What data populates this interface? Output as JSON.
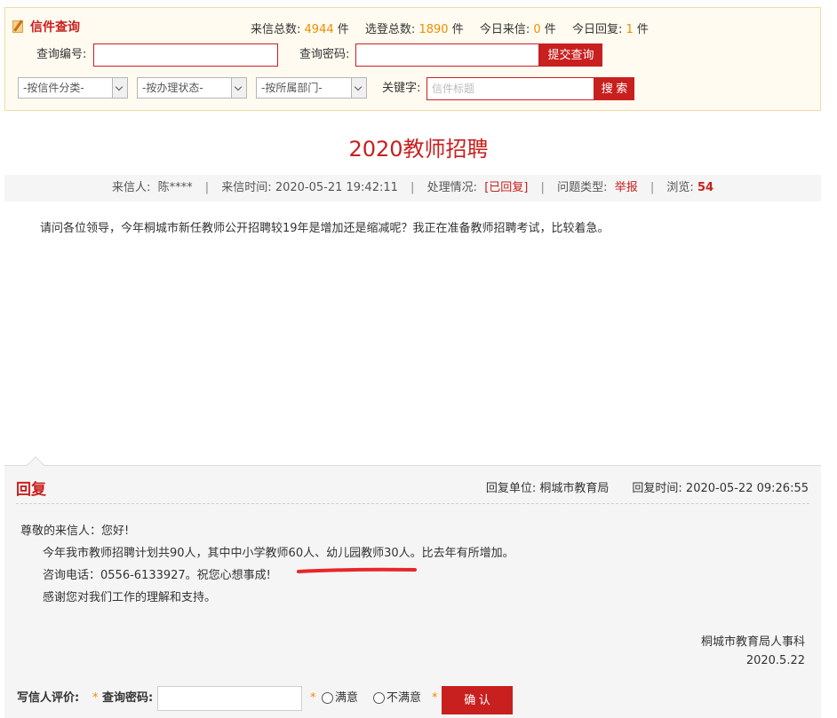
{
  "query": {
    "title": "信件查询",
    "stats": {
      "total_label": "来信总数:",
      "total_value": "4944",
      "selected_label": "选登总数:",
      "selected_value": "1890",
      "today_in_label": "今日来信:",
      "today_in_value": "0",
      "today_reply_label": "今日回复:",
      "today_reply_value": "1",
      "unit": "件"
    },
    "number_label": "查询编号:",
    "number_value": "",
    "password_label": "查询密码:",
    "password_value": "",
    "submit_label": "提交查询",
    "category_select": "-按信件分类-",
    "status_select": "-按办理状态-",
    "department_select": "-按所属部门-",
    "keyword_label": "关键字:",
    "keyword_placeholder": "信件标题",
    "search_label": "搜 索"
  },
  "letter": {
    "title": "2020教师招聘",
    "sender_label": "来信人:",
    "sender": "陈****",
    "time_label": "来信时间:",
    "time": "2020-05-21 19:42:11",
    "status_label": "处理情况:",
    "status": "[已回复]",
    "type_label": "问题类型:",
    "type": "举报",
    "views_label": "浏览:",
    "views": "54",
    "separator": "|",
    "body": "请问各位领导，今年桐城市新任教师公开招聘较19年是增加还是缩减呢？我正在准备教师招聘考试，比较着急。"
  },
  "reply": {
    "heading": "回复",
    "unit_label": "回复单位:",
    "unit": "桐城市教育局",
    "time_label": "回复时间:",
    "time": "2020-05-22 09:26:55",
    "greeting": "尊敬的来信人：您好!",
    "line1": "今年我市教师招聘计划共90人，其中中小学教师60人、幼儿园教师30人。比去年有所增加。",
    "line2": "咨询电话：0556-6133927。祝您心想事成!",
    "line3": "感谢您对我们工作的理解和支持。",
    "signature": "桐城市教育局人事科",
    "date": "2020.5.22",
    "highlight_color": "#e8262b"
  },
  "evaluation": {
    "label": "写信人评价:",
    "star": "*",
    "password_label": "查询密码:",
    "password_value": "",
    "satisfied": "满意",
    "unsatisfied": "不满意",
    "confirm": "确 认"
  }
}
